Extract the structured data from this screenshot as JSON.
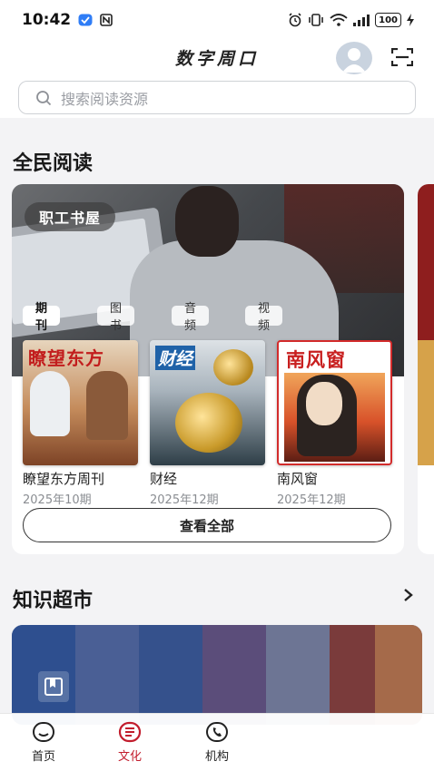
{
  "status_bar": {
    "time": "10:42",
    "battery": "100"
  },
  "header": {
    "title": "数字周口"
  },
  "search": {
    "placeholder": "搜索阅读资源"
  },
  "reading_section": {
    "title": "全民阅读",
    "hero_tag": "职工书屋",
    "tabs": [
      {
        "label": "期刊",
        "active": true
      },
      {
        "label": "图书",
        "active": false
      },
      {
        "label": "音频",
        "active": false
      },
      {
        "label": "视频",
        "active": false
      }
    ],
    "magazines": [
      {
        "name": "瞭望东方周刊",
        "issue": "2025年10期",
        "cover_title": "瞭望东方"
      },
      {
        "name": "财经",
        "issue": "2025年12期",
        "cover_title": "财经"
      },
      {
        "name": "南风窗",
        "issue": "2025年12期",
        "cover_title": "南风窗"
      }
    ],
    "view_all_label": "查看全部"
  },
  "market_section": {
    "title": "知识超市"
  },
  "bottom_nav": {
    "items": [
      {
        "label": "首页",
        "icon": "home-icon",
        "active": false
      },
      {
        "label": "文化",
        "icon": "culture-icon",
        "active": true
      },
      {
        "label": "机构",
        "icon": "phone-icon",
        "active": false
      }
    ]
  },
  "colors": {
    "accent": "#c21d2d",
    "background": "#f3f3f5"
  }
}
